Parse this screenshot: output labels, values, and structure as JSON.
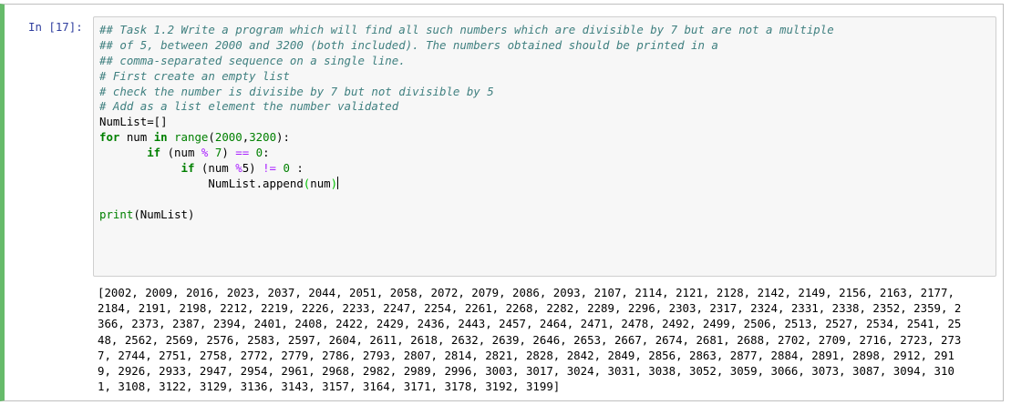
{
  "cell": {
    "prompt": "In [17]:",
    "code": [
      [
        {
          "t": "## Task 1.2 Write a program which will find all such numbers which are divisible by 7 but are not a multiple",
          "c": "cm"
        }
      ],
      [
        {
          "t": "## of 5, between 2000 and 3200 (both included). The numbers obtained should be printed in a",
          "c": "cm"
        }
      ],
      [
        {
          "t": "## comma-separated sequence on a single line.",
          "c": "cm"
        }
      ],
      [
        {
          "t": "# First create an empty list",
          "c": "cm"
        }
      ],
      [
        {
          "t": "# check the number is divisibe by 7 but not divisible by 5",
          "c": "cm"
        }
      ],
      [
        {
          "t": "# Add as a list element the number validated",
          "c": "cm"
        }
      ],
      [
        {
          "t": "NumList=[]",
          "c": ""
        }
      ],
      [
        {
          "t": "for",
          "c": "kw"
        },
        {
          "t": " num ",
          "c": ""
        },
        {
          "t": "in",
          "c": "kw"
        },
        {
          "t": " ",
          "c": ""
        },
        {
          "t": "range",
          "c": "bi"
        },
        {
          "t": "(",
          "c": ""
        },
        {
          "t": "2000",
          "c": "num"
        },
        {
          "t": ",",
          "c": ""
        },
        {
          "t": "3200",
          "c": "num"
        },
        {
          "t": "):",
          "c": ""
        }
      ],
      [
        {
          "t": "       ",
          "c": ""
        },
        {
          "t": "if",
          "c": "kw"
        },
        {
          "t": " (num ",
          "c": ""
        },
        {
          "t": "%",
          "c": "op"
        },
        {
          "t": " ",
          "c": ""
        },
        {
          "t": "7",
          "c": "num"
        },
        {
          "t": ") ",
          "c": ""
        },
        {
          "t": "==",
          "c": "op"
        },
        {
          "t": " ",
          "c": ""
        },
        {
          "t": "0",
          "c": "num"
        },
        {
          "t": ":",
          "c": ""
        }
      ],
      [
        {
          "t": "            ",
          "c": ""
        },
        {
          "t": "if",
          "c": "kw"
        },
        {
          "t": " (num ",
          "c": ""
        },
        {
          "t": "%",
          "c": "op"
        },
        {
          "t": "5) ",
          "c": ""
        },
        {
          "t": "!=",
          "c": "op"
        },
        {
          "t": " ",
          "c": ""
        },
        {
          "t": "0",
          "c": "num"
        },
        {
          "t": " :",
          "c": ""
        }
      ],
      [
        {
          "t": "                NumList.append",
          "c": ""
        },
        {
          "t": "(",
          "c": "bracket"
        },
        {
          "t": "num",
          "c": ""
        },
        {
          "t": ")",
          "c": "bracket"
        },
        {
          "t": "|",
          "c": "cursor"
        }
      ],
      [
        {
          "t": "",
          "c": ""
        }
      ],
      [
        {
          "t": "print",
          "c": "bi"
        },
        {
          "t": "(NumList)",
          "c": ""
        }
      ]
    ],
    "output_lines": [
      "[2002, 2009, 2016, 2023, 2037, 2044, 2051, 2058, 2072, 2079, 2086, 2093, 2107, 2114, 2121, 2128, 2142, 2149, 2156, 2163, 2177,",
      "2184, 2191, 2198, 2212, 2219, 2226, 2233, 2247, 2254, 2261, 2268, 2282, 2289, 2296, 2303, 2317, 2324, 2331, 2338, 2352, 2359, 2",
      "366, 2373, 2387, 2394, 2401, 2408, 2422, 2429, 2436, 2443, 2457, 2464, 2471, 2478, 2492, 2499, 2506, 2513, 2527, 2534, 2541, 25",
      "48, 2562, 2569, 2576, 2583, 2597, 2604, 2611, 2618, 2632, 2639, 2646, 2653, 2667, 2674, 2681, 2688, 2702, 2709, 2716, 2723, 273",
      "7, 2744, 2751, 2758, 2772, 2779, 2786, 2793, 2807, 2814, 2821, 2828, 2842, 2849, 2856, 2863, 2877, 2884, 2891, 2898, 2912, 291",
      "9, 2926, 2933, 2947, 2954, 2961, 2968, 2982, 2989, 2996, 3003, 3017, 3024, 3031, 3038, 3052, 3059, 3066, 3073, 3087, 3094, 310",
      "1, 3108, 3122, 3129, 3136, 3143, 3157, 3164, 3171, 3178, 3192, 3199]"
    ]
  },
  "colors": {
    "active_cell_border": "#66bb6a",
    "prompt": "#303f9f",
    "comment": "#408080",
    "keyword": "#008000",
    "operator": "#aa22ff"
  }
}
